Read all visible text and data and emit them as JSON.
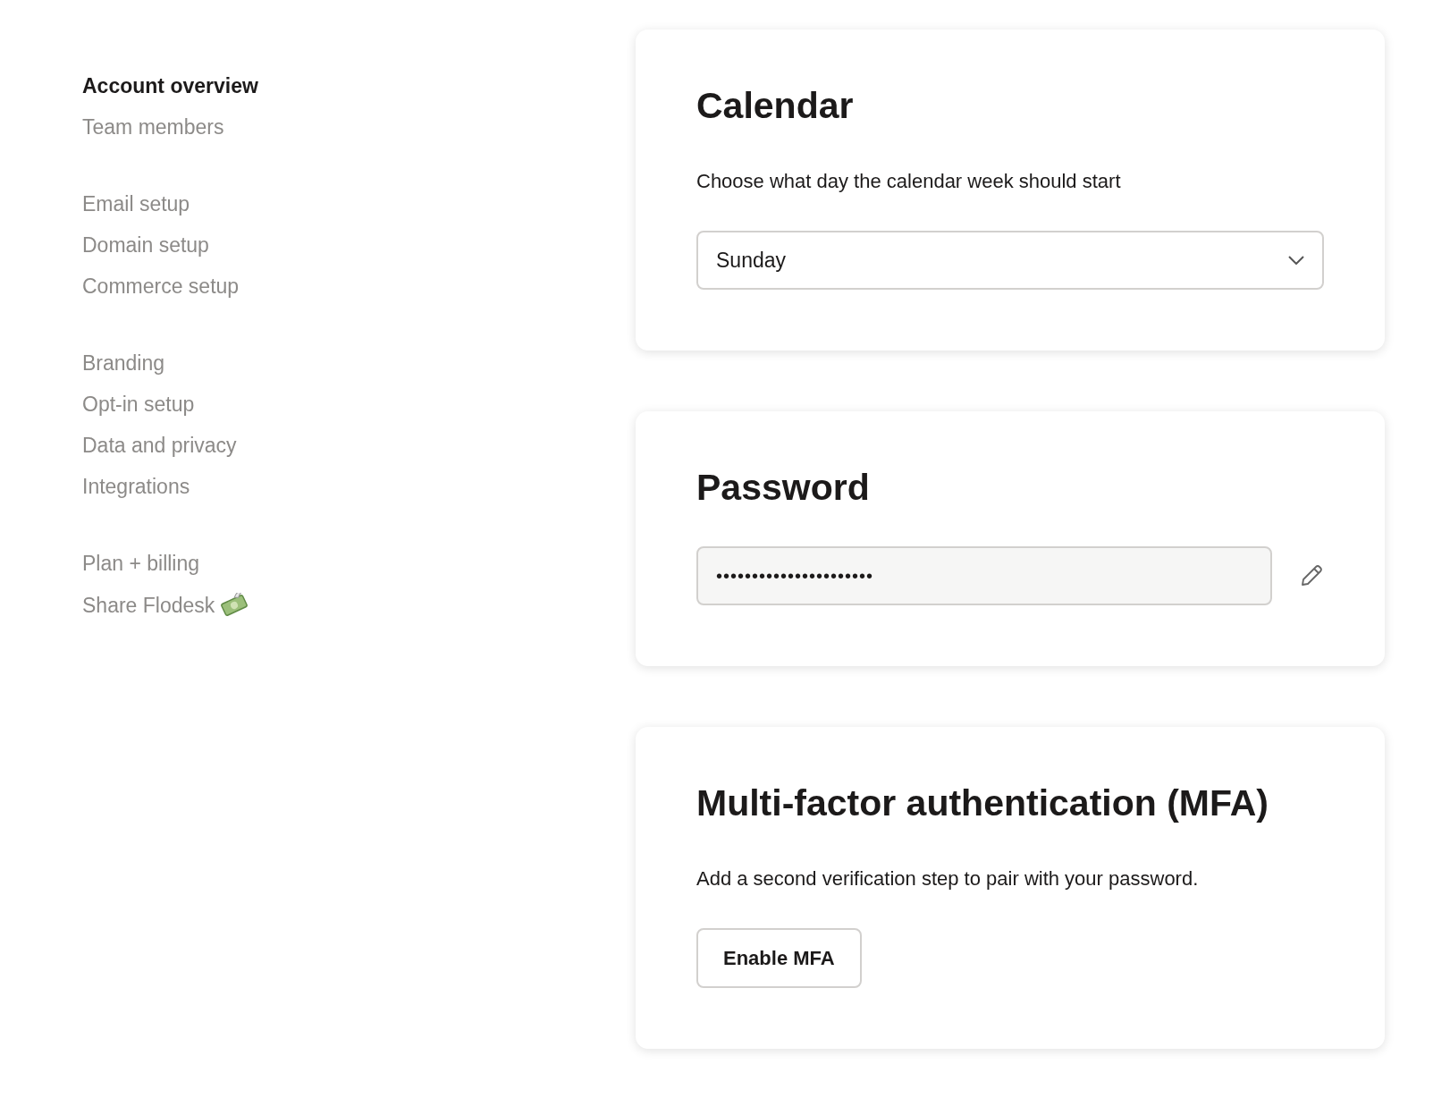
{
  "sidebar": {
    "groups": [
      [
        {
          "label": "Account overview",
          "selected": true
        },
        {
          "label": "Team members",
          "selected": false
        }
      ],
      [
        {
          "label": "Email setup",
          "selected": false
        },
        {
          "label": "Domain setup",
          "selected": false
        },
        {
          "label": "Commerce setup",
          "selected": false
        }
      ],
      [
        {
          "label": "Branding",
          "selected": false
        },
        {
          "label": "Opt-in setup",
          "selected": false
        },
        {
          "label": "Data and privacy",
          "selected": false
        },
        {
          "label": "Integrations",
          "selected": false
        }
      ],
      [
        {
          "label": "Plan + billing",
          "selected": false
        },
        {
          "label": "Share Flodesk",
          "selected": false,
          "kind": "decorated"
        }
      ]
    ]
  },
  "cards": [
    {
      "kind": "select",
      "title": "Calendar",
      "description": "Choose what day the calendar week should start",
      "value": "Sunday"
    },
    {
      "kind": "password",
      "title": "Password",
      "value": "••••••••••••••••••••••"
    },
    {
      "kind": "action",
      "title": "Multi-factor authentication (MFA)",
      "description": "Add a second verification step to pair with your password.",
      "button": "Enable MFA"
    }
  ]
}
